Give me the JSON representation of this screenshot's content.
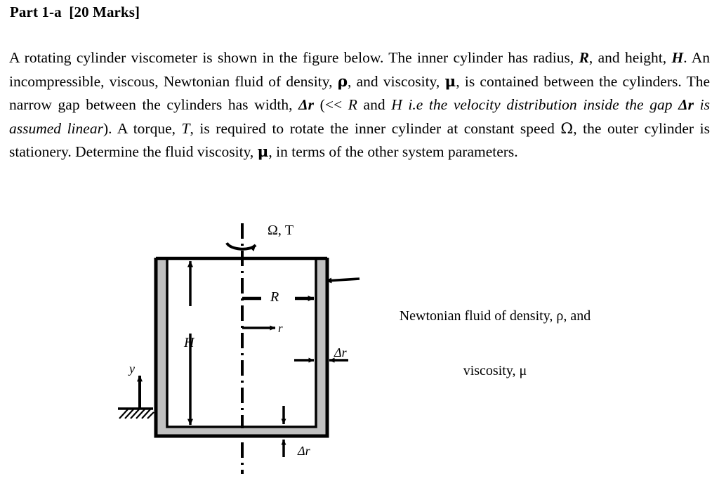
{
  "document": {
    "heading": "Part 1-a  [20 Marks]",
    "paragraph": {
      "seg1": "A rotating cylinder viscometer is shown in the figure below. The inner cylinder has radius, ",
      "var_R": "R",
      "seg2": ", and height, ",
      "var_H": "H",
      "seg3": ". An incompressible, viscous, Newtonian fluid of density, ",
      "var_rho": "ρ",
      "seg4": ", and viscosity, ",
      "var_mu": "μ",
      "seg5": ", is contained between the cylinders. The narrow gap between the cylinders has width, ",
      "var_dr": "Δr",
      "seg6": " (<< ",
      "var_R2": "R",
      "seg7": " and ",
      "var_H2": "H",
      "italic_clause": " i.e the velocity distribution inside the gap ",
      "var_dr2": "Δr",
      "italic_clause2": " is assumed linear",
      "seg8": "). A torque, ",
      "var_T": "T",
      "seg9": ", is required to rotate the inner cylinder at constant speed ",
      "var_omega": "Ω",
      "seg10": ", the outer cylinder is stationery. Determine the fluid viscosity, ",
      "var_mu2": "μ",
      "seg11": ", in terms of the other system parameters."
    }
  },
  "figure": {
    "labels": {
      "omega_torque": "Ω, T",
      "radius_R": "R",
      "radial_r": "r",
      "height_H": "H",
      "gap_side": "Δr",
      "gap_bottom": "Δr",
      "vertical_y": "y"
    },
    "callout": {
      "line1": "Newtonian fluid of density, ρ, and",
      "line2": "viscosity, μ"
    },
    "colors": {
      "stroke": "#000000",
      "wall_fill": "#c0c0c0",
      "background": "#ffffff"
    }
  }
}
